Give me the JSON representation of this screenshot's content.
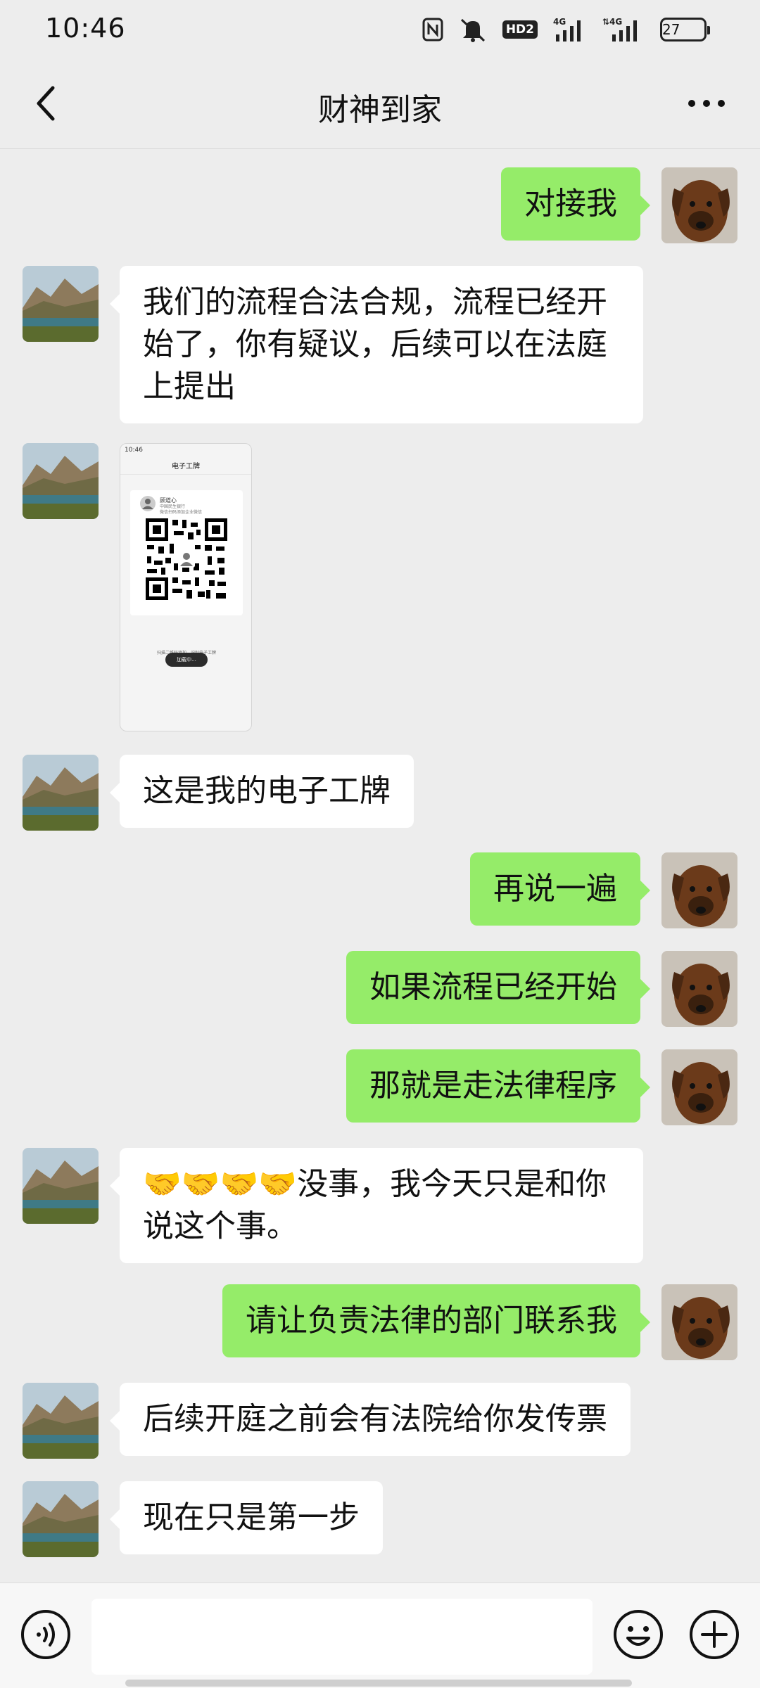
{
  "status_bar": {
    "time": "10:46",
    "battery": "27",
    "network1": "4G",
    "network2": "4G",
    "hd": "HD2"
  },
  "header": {
    "title": "财神到家"
  },
  "messages": [
    {
      "side": "out",
      "text": "对接我"
    },
    {
      "side": "in",
      "text": "我们的流程合法合规，流程已经开始了，你有疑议，后续可以在法庭上提出"
    },
    {
      "side": "in",
      "type": "image",
      "image": {
        "status_time": "10:46",
        "title": "电子工牌",
        "name": "顾道心",
        "sub1": "中国民生银行",
        "sub2": "微信扫码添加企业微信",
        "caption": "扫描二维码添加，识别电子工牌",
        "loading": "加载中..."
      }
    },
    {
      "side": "in",
      "text": "这是我的电子工牌"
    },
    {
      "side": "out",
      "text": "再说一遍"
    },
    {
      "side": "out",
      "text": "如果流程已经开始"
    },
    {
      "side": "out",
      "text": "那就是走法律程序"
    },
    {
      "side": "in",
      "text": "🤝🤝🤝🤝没事，我今天只是和你说这个事。"
    },
    {
      "side": "out",
      "text": "请让负责法律的部门联系我"
    },
    {
      "side": "in",
      "text": "后续开庭之前会有法院给你发传票"
    },
    {
      "side": "in",
      "text": "现在只是第一步"
    }
  ],
  "input": {
    "value": "",
    "placeholder": ""
  },
  "colors": {
    "background": "#ededed",
    "outgoing_bubble": "#95ec69",
    "incoming_bubble": "#ffffff"
  },
  "icons": {
    "back": "chevron-left-icon",
    "more": "more-dots-icon",
    "voice": "voice-icon",
    "emoji": "emoji-icon",
    "plus": "plus-icon"
  }
}
